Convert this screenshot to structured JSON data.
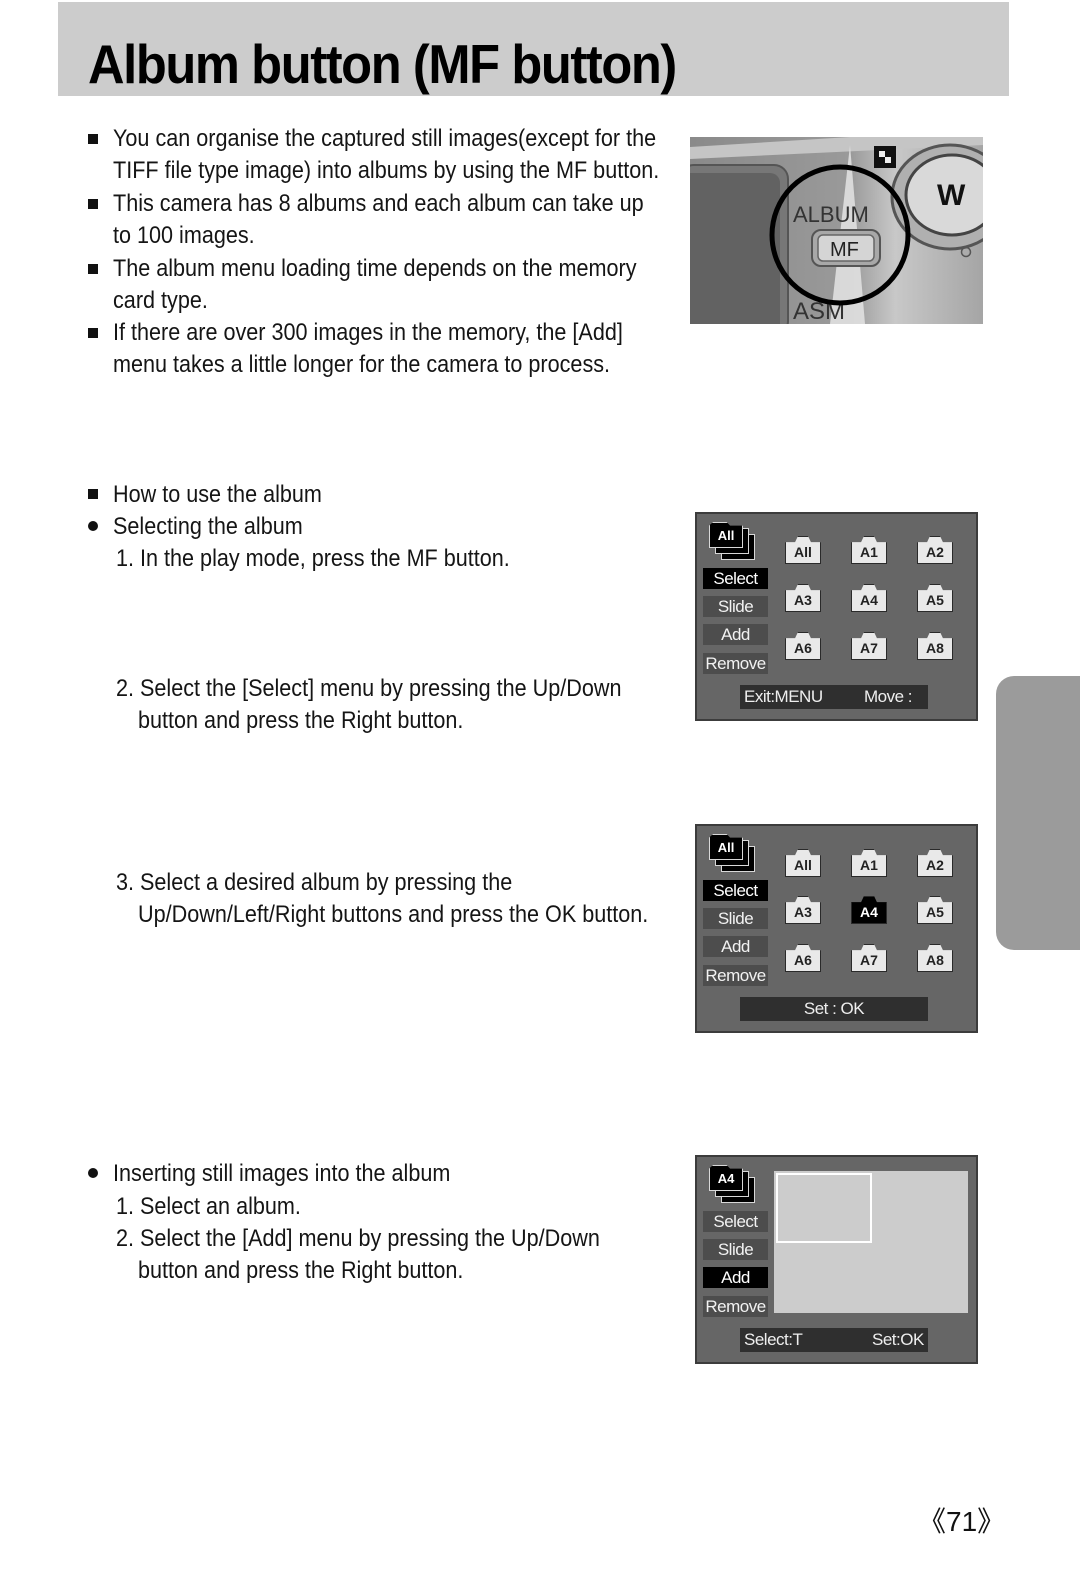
{
  "page": {
    "title": "Album button (MF button)",
    "page_number": "《71》"
  },
  "intro": {
    "bullets": [
      [
        "You can organise the captured still images(except for the",
        "TIFF file type image) into albums by using the MF button."
      ],
      [
        "This camera has 8 albums and each album can take up",
        "to 100 images."
      ],
      [
        "The album menu loading time depends on the memory",
        "card type."
      ],
      [
        "If there are over 300 images in the memory, the [Add]",
        "menu takes a little longer for the camera to process."
      ]
    ]
  },
  "how_to": {
    "heading": "How to use the album",
    "selecting": {
      "heading": "Selecting the album",
      "steps": [
        [
          "1. In the play mode, press the MF button."
        ],
        [
          "2. Select the [Select] menu by pressing the Up/Down",
          "button and press the Right button."
        ],
        [
          "3. Select a desired album by pressing the",
          "Up/Down/Left/Right buttons and press the OK button."
        ]
      ]
    },
    "inserting": {
      "heading": "Inserting still images into the album",
      "steps": [
        [
          "1. Select an album."
        ],
        [
          "2. Select the [Add] menu by pressing the Up/Down",
          "button and press the Right button."
        ]
      ]
    }
  },
  "camera_image": {
    "labels": {
      "album": "ALBUM",
      "mf": "MF",
      "asm": "ASM",
      "zoom_w": "W"
    }
  },
  "screens": [
    {
      "stack_label": "All",
      "menu": [
        "Select",
        "Slide",
        "Add",
        "Remove"
      ],
      "active_menu": "Select",
      "albums": [
        "All",
        "A1",
        "A2",
        "A3",
        "A4",
        "A5",
        "A6",
        "A7",
        "A8"
      ],
      "active_album": null,
      "status_left": "Exit:MENU",
      "status_right": "Move :"
    },
    {
      "stack_label": "All",
      "menu": [
        "Select",
        "Slide",
        "Add",
        "Remove"
      ],
      "active_menu": "Select",
      "albums": [
        "All",
        "A1",
        "A2",
        "A3",
        "A4",
        "A5",
        "A6",
        "A7",
        "A8"
      ],
      "active_album": "A4",
      "status_center": "Set : OK"
    },
    {
      "stack_label": "A4",
      "menu": [
        "Select",
        "Slide",
        "Add",
        "Remove"
      ],
      "active_menu": "Add",
      "status_left": "Select:T",
      "status_right": "Set:OK"
    }
  ],
  "colors": {
    "title_bar": "#cccccc",
    "lcd_bg": "#666666",
    "menu_inactive": "#4d4d4d",
    "menu_active": "#000000",
    "side_tab": "#9b9b9b"
  }
}
